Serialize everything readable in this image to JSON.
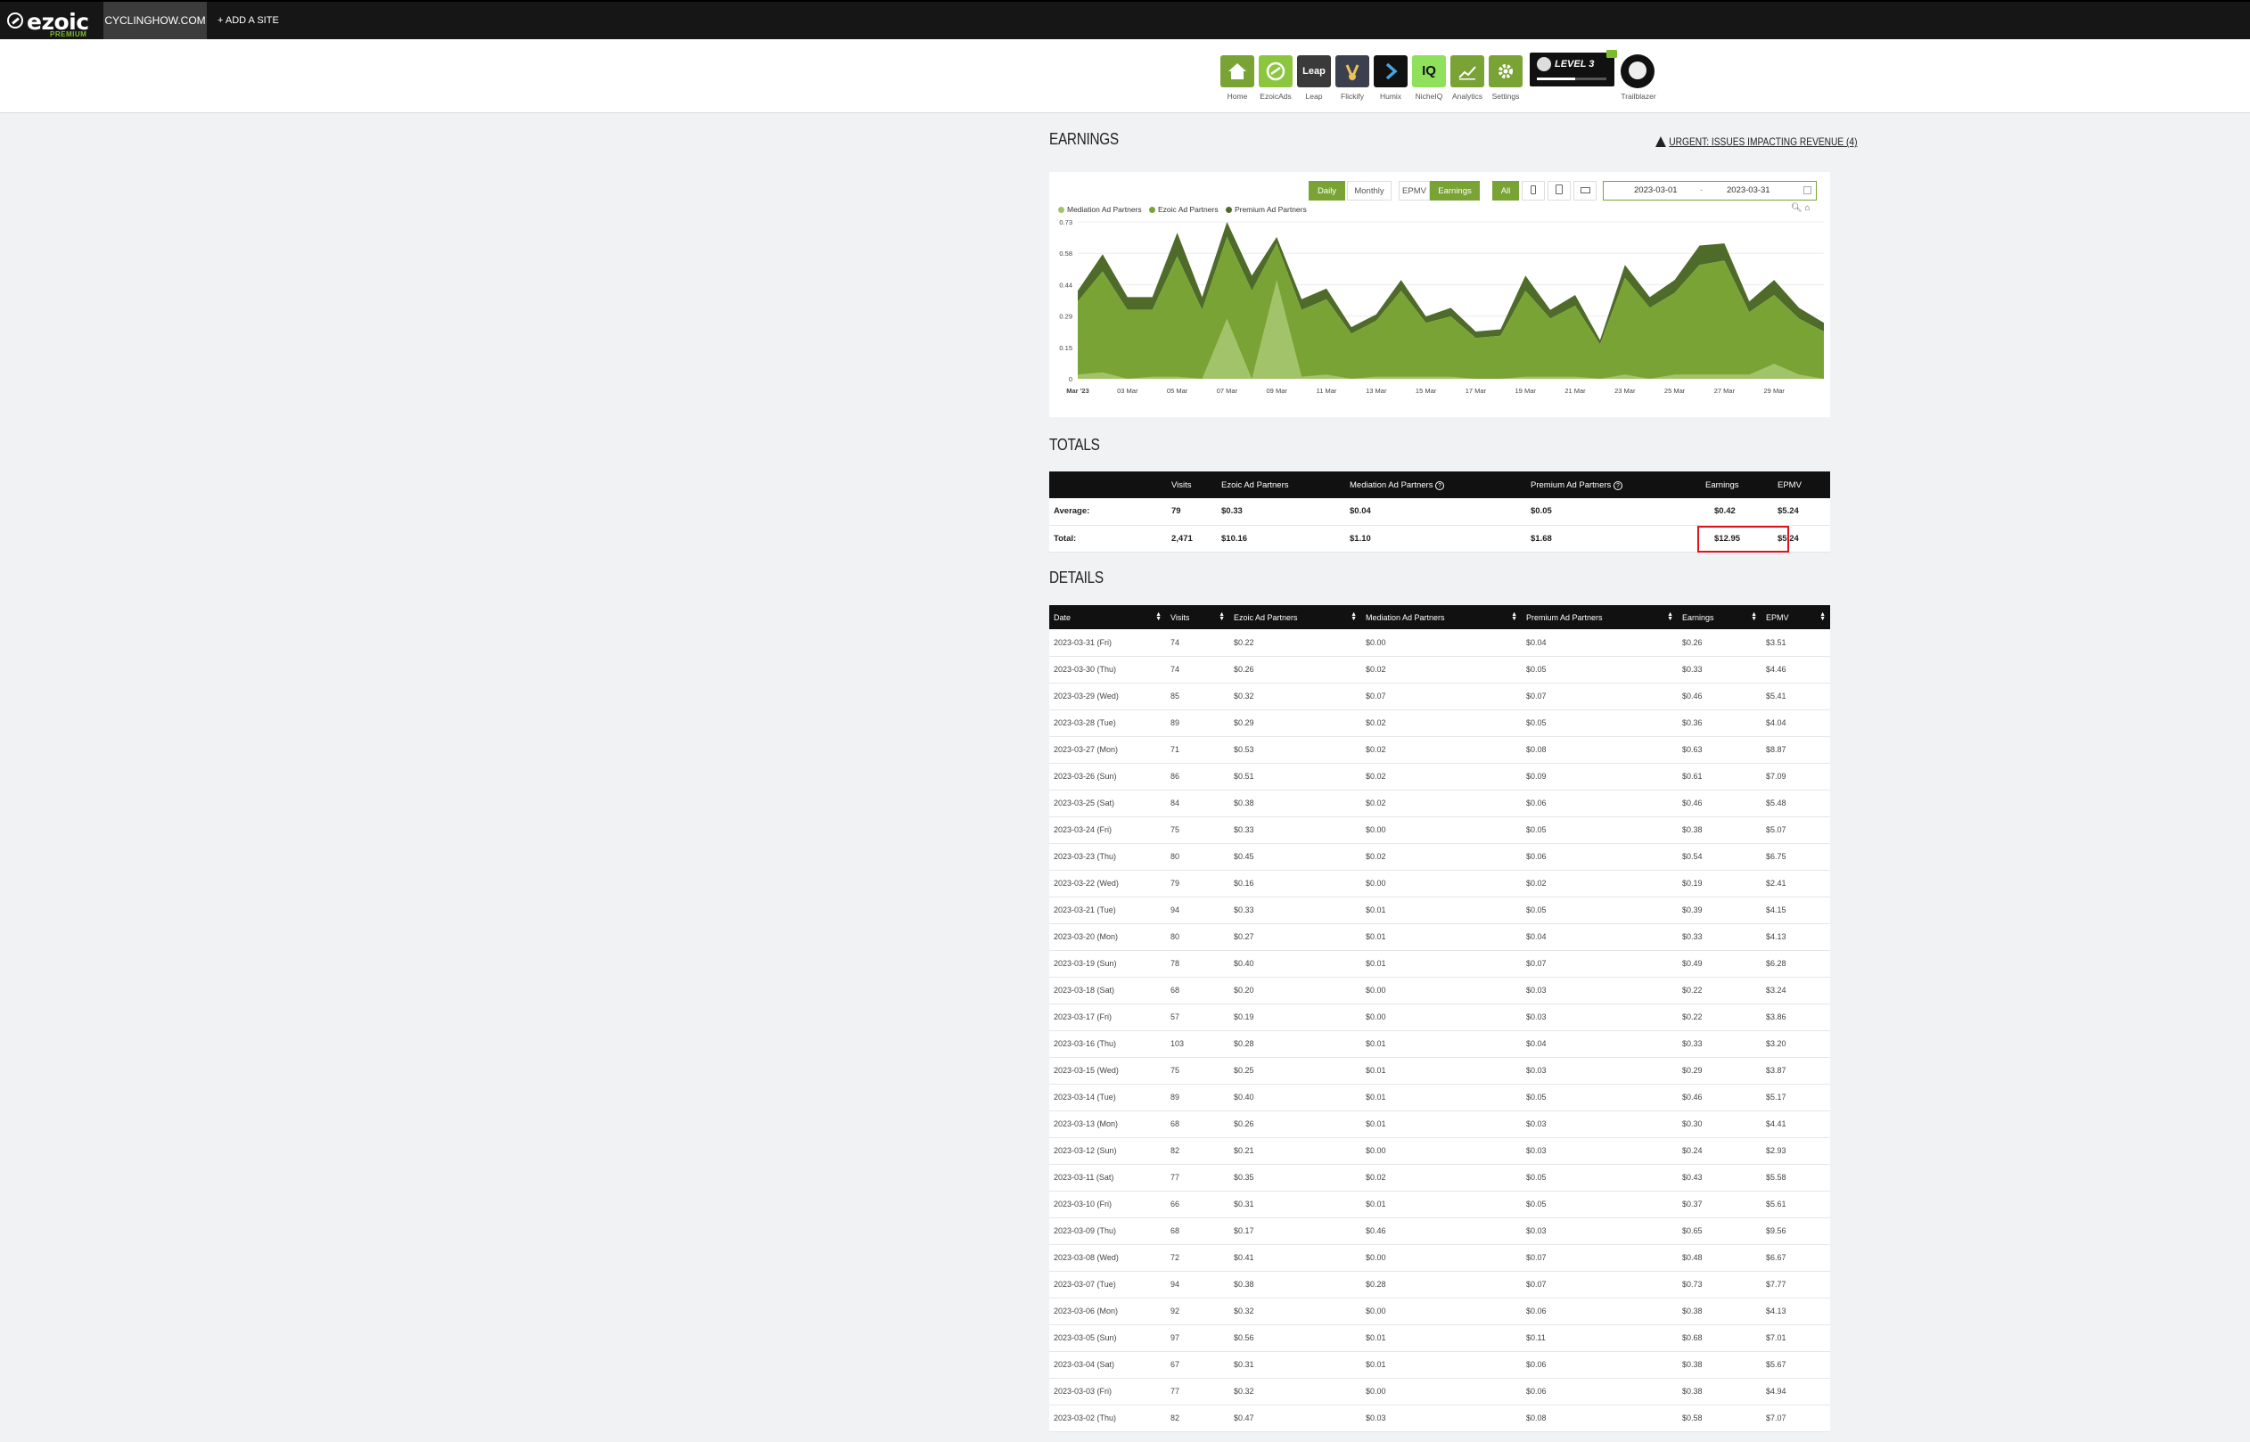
{
  "topbar": {
    "logo_text": "ezoic",
    "logo_sub": "PREMIUM",
    "site": "CYCLINGHOW.COM",
    "add_site": "+ ADD A SITE"
  },
  "apps": [
    {
      "label": "Home",
      "icon": "home-icon",
      "color": "#7aa336"
    },
    {
      "label": "EzoicAds",
      "icon": "ezoicads-icon",
      "color": "#8cc63f"
    },
    {
      "label": "Leap",
      "icon": "leap-icon",
      "color": "#3a3a3a",
      "text": "Leap"
    },
    {
      "label": "Flickify",
      "icon": "flickify-icon",
      "color": "#3c3f4d"
    },
    {
      "label": "Humix",
      "icon": "humix-icon",
      "color": "#111111"
    },
    {
      "label": "NicheIQ",
      "icon": "nicheiq-icon",
      "color": "#8fe05a",
      "text": "IQ"
    },
    {
      "label": "Analytics",
      "icon": "analytics-icon",
      "color": "#7aa336"
    },
    {
      "label": "Settings",
      "icon": "settings-icon",
      "color": "#7aa336"
    }
  ],
  "level": {
    "text": "LEVEL 3",
    "progress": 0.55
  },
  "trailblazer_label": "Trailblazer",
  "earnings": {
    "title": "EARNINGS",
    "urgent": "URGENT: ISSUES IMPACTING REVENUE (4)",
    "buttons": {
      "daily": "Daily",
      "monthly": "Monthly",
      "epmv": "EPMV",
      "earnings": "Earnings",
      "all": "All"
    },
    "date_from": "2023-03-01",
    "date_sep": "-",
    "date_to": "2023-03-31"
  },
  "chart_data": {
    "type": "area",
    "stacked": true,
    "legend": [
      "Mediation Ad Partners",
      "Ezoic Ad Partners",
      "Premium Ad Partners"
    ],
    "legend_colors": [
      "#a3c36a",
      "#7aa336",
      "#4e6b2a"
    ],
    "x_tick_labels": [
      "Mar '23",
      "03 Mar",
      "05 Mar",
      "07 Mar",
      "09 Mar",
      "11 Mar",
      "13 Mar",
      "15 Mar",
      "17 Mar",
      "19 Mar",
      "21 Mar",
      "23 Mar",
      "25 Mar",
      "27 Mar",
      "29 Mar"
    ],
    "y_tick_labels": [
      "0",
      "0.15",
      "0.29",
      "0.44",
      "0.58",
      "0.73"
    ],
    "ylim": [
      0,
      0.73
    ],
    "x": [
      "2023-03-01",
      "2023-03-02",
      "2023-03-03",
      "2023-03-04",
      "2023-03-05",
      "2023-03-06",
      "2023-03-07",
      "2023-03-08",
      "2023-03-09",
      "2023-03-10",
      "2023-03-11",
      "2023-03-12",
      "2023-03-13",
      "2023-03-14",
      "2023-03-15",
      "2023-03-16",
      "2023-03-17",
      "2023-03-18",
      "2023-03-19",
      "2023-03-20",
      "2023-03-21",
      "2023-03-22",
      "2023-03-23",
      "2023-03-24",
      "2023-03-25",
      "2023-03-26",
      "2023-03-27",
      "2023-03-28",
      "2023-03-29",
      "2023-03-30",
      "2023-03-31"
    ],
    "series": [
      {
        "name": "Mediation Ad Partners",
        "values": [
          0.02,
          0.03,
          0.0,
          0.01,
          0.01,
          0.0,
          0.28,
          0.0,
          0.46,
          0.01,
          0.02,
          0.0,
          0.01,
          0.01,
          0.01,
          0.01,
          0.0,
          0.0,
          0.01,
          0.01,
          0.01,
          0.0,
          0.02,
          0.0,
          0.02,
          0.02,
          0.02,
          0.02,
          0.07,
          0.02,
          0.0
        ]
      },
      {
        "name": "Ezoic Ad Partners",
        "values": [
          0.34,
          0.47,
          0.32,
          0.31,
          0.56,
          0.32,
          0.38,
          0.41,
          0.17,
          0.31,
          0.35,
          0.21,
          0.26,
          0.4,
          0.25,
          0.28,
          0.19,
          0.2,
          0.4,
          0.27,
          0.33,
          0.16,
          0.45,
          0.33,
          0.38,
          0.51,
          0.53,
          0.29,
          0.32,
          0.26,
          0.22
        ]
      },
      {
        "name": "Premium Ad Partners",
        "values": [
          0.05,
          0.08,
          0.06,
          0.06,
          0.11,
          0.06,
          0.07,
          0.07,
          0.03,
          0.05,
          0.05,
          0.03,
          0.03,
          0.05,
          0.03,
          0.04,
          0.03,
          0.03,
          0.07,
          0.04,
          0.05,
          0.02,
          0.06,
          0.05,
          0.06,
          0.09,
          0.08,
          0.05,
          0.07,
          0.05,
          0.04
        ]
      }
    ]
  },
  "totals": {
    "title": "TOTALS",
    "headers": [
      "",
      "Visits",
      "Ezoic Ad Partners",
      "Mediation Ad Partners",
      "Premium Ad Partners",
      "Earnings",
      "EPMV"
    ],
    "rows": [
      [
        "Average:",
        "79",
        "$0.33",
        "$0.04",
        "$0.05",
        "$0.42",
        "$5.24"
      ],
      [
        "Total:",
        "2,471",
        "$10.16",
        "$1.10",
        "$1.68",
        "$12.95",
        "$5.24"
      ]
    ]
  },
  "details": {
    "title": "DETAILS",
    "headers": [
      "Date",
      "Visits",
      "Ezoic Ad Partners",
      "Mediation Ad Partners",
      "Premium Ad Partners",
      "Earnings",
      "EPMV"
    ],
    "rows": [
      [
        "2023-03-31 (Fri)",
        "74",
        "$0.22",
        "$0.00",
        "$0.04",
        "$0.26",
        "$3.51"
      ],
      [
        "2023-03-30 (Thu)",
        "74",
        "$0.26",
        "$0.02",
        "$0.05",
        "$0.33",
        "$4.46"
      ],
      [
        "2023-03-29 (Wed)",
        "85",
        "$0.32",
        "$0.07",
        "$0.07",
        "$0.46",
        "$5.41"
      ],
      [
        "2023-03-28 (Tue)",
        "89",
        "$0.29",
        "$0.02",
        "$0.05",
        "$0.36",
        "$4.04"
      ],
      [
        "2023-03-27 (Mon)",
        "71",
        "$0.53",
        "$0.02",
        "$0.08",
        "$0.63",
        "$8.87"
      ],
      [
        "2023-03-26 (Sun)",
        "86",
        "$0.51",
        "$0.02",
        "$0.09",
        "$0.61",
        "$7.09"
      ],
      [
        "2023-03-25 (Sat)",
        "84",
        "$0.38",
        "$0.02",
        "$0.06",
        "$0.46",
        "$5.48"
      ],
      [
        "2023-03-24 (Fri)",
        "75",
        "$0.33",
        "$0.00",
        "$0.05",
        "$0.38",
        "$5.07"
      ],
      [
        "2023-03-23 (Thu)",
        "80",
        "$0.45",
        "$0.02",
        "$0.06",
        "$0.54",
        "$6.75"
      ],
      [
        "2023-03-22 (Wed)",
        "79",
        "$0.16",
        "$0.00",
        "$0.02",
        "$0.19",
        "$2.41"
      ],
      [
        "2023-03-21 (Tue)",
        "94",
        "$0.33",
        "$0.01",
        "$0.05",
        "$0.39",
        "$4.15"
      ],
      [
        "2023-03-20 (Mon)",
        "80",
        "$0.27",
        "$0.01",
        "$0.04",
        "$0.33",
        "$4.13"
      ],
      [
        "2023-03-19 (Sun)",
        "78",
        "$0.40",
        "$0.01",
        "$0.07",
        "$0.49",
        "$6.28"
      ],
      [
        "2023-03-18 (Sat)",
        "68",
        "$0.20",
        "$0.00",
        "$0.03",
        "$0.22",
        "$3.24"
      ],
      [
        "2023-03-17 (Fri)",
        "57",
        "$0.19",
        "$0.00",
        "$0.03",
        "$0.22",
        "$3.86"
      ],
      [
        "2023-03-16 (Thu)",
        "103",
        "$0.28",
        "$0.01",
        "$0.04",
        "$0.33",
        "$3.20"
      ],
      [
        "2023-03-15 (Wed)",
        "75",
        "$0.25",
        "$0.01",
        "$0.03",
        "$0.29",
        "$3.87"
      ],
      [
        "2023-03-14 (Tue)",
        "89",
        "$0.40",
        "$0.01",
        "$0.05",
        "$0.46",
        "$5.17"
      ],
      [
        "2023-03-13 (Mon)",
        "68",
        "$0.26",
        "$0.01",
        "$0.03",
        "$0.30",
        "$4.41"
      ],
      [
        "2023-03-12 (Sun)",
        "82",
        "$0.21",
        "$0.00",
        "$0.03",
        "$0.24",
        "$2.93"
      ],
      [
        "2023-03-11 (Sat)",
        "77",
        "$0.35",
        "$0.02",
        "$0.05",
        "$0.43",
        "$5.58"
      ],
      [
        "2023-03-10 (Fri)",
        "66",
        "$0.31",
        "$0.01",
        "$0.05",
        "$0.37",
        "$5.61"
      ],
      [
        "2023-03-09 (Thu)",
        "68",
        "$0.17",
        "$0.46",
        "$0.03",
        "$0.65",
        "$9.56"
      ],
      [
        "2023-03-08 (Wed)",
        "72",
        "$0.41",
        "$0.00",
        "$0.07",
        "$0.48",
        "$6.67"
      ],
      [
        "2023-03-07 (Tue)",
        "94",
        "$0.38",
        "$0.28",
        "$0.07",
        "$0.73",
        "$7.77"
      ],
      [
        "2023-03-06 (Mon)",
        "92",
        "$0.32",
        "$0.00",
        "$0.06",
        "$0.38",
        "$4.13"
      ],
      [
        "2023-03-05 (Sun)",
        "97",
        "$0.56",
        "$0.01",
        "$0.11",
        "$0.68",
        "$7.01"
      ],
      [
        "2023-03-04 (Sat)",
        "67",
        "$0.31",
        "$0.01",
        "$0.06",
        "$0.38",
        "$5.67"
      ],
      [
        "2023-03-03 (Fri)",
        "77",
        "$0.32",
        "$0.00",
        "$0.06",
        "$0.38",
        "$4.94"
      ],
      [
        "2023-03-02 (Thu)",
        "82",
        "$0.47",
        "$0.03",
        "$0.08",
        "$0.58",
        "$7.07"
      ]
    ]
  }
}
